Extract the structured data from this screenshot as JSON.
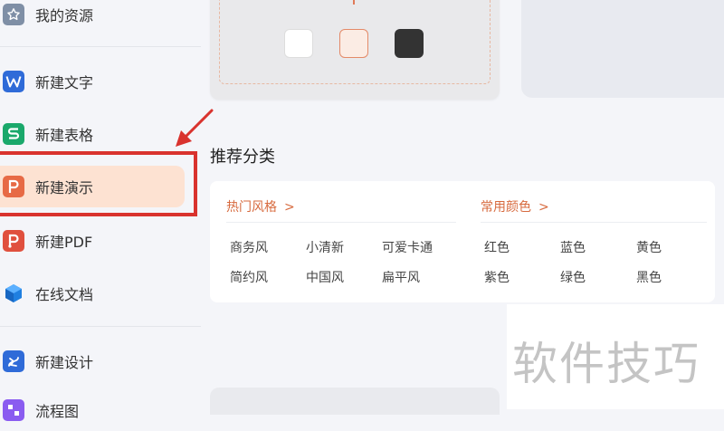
{
  "sidebar": {
    "items": [
      {
        "label": "我的资源",
        "icon": "star-icon",
        "color": "#7f8fa6"
      },
      {
        "label": "新建文字",
        "icon": "wps-writer-icon",
        "color": "#2f6bd8"
      },
      {
        "label": "新建表格",
        "icon": "wps-spreadsheet-icon",
        "color": "#1aa86b"
      },
      {
        "label": "新建演示",
        "icon": "wps-presentation-icon",
        "color": "#e76a45"
      },
      {
        "label": "新建PDF",
        "icon": "pdf-icon",
        "color": "#e0503e"
      },
      {
        "label": "在线文档",
        "icon": "online-doc-icon",
        "color": "#1f7fe0"
      },
      {
        "label": "新建设计",
        "icon": "design-icon",
        "color": "#2f6bd8"
      },
      {
        "label": "流程图",
        "icon": "flowchart-icon",
        "color": "#8a5cf0"
      }
    ],
    "active_index": 3
  },
  "template_preview": {
    "swatches": [
      "#ffffff",
      "#fbece4",
      "#333333"
    ],
    "selected_swatch": 1
  },
  "recommend": {
    "title": "推荐分类",
    "groups": [
      {
        "heading": "热门风格",
        "chevron": ">",
        "tags": [
          "商务风",
          "小清新",
          "可爱卡通",
          "简约风",
          "中国风",
          "扁平风"
        ]
      },
      {
        "heading": "常用颜色",
        "chevron": ">",
        "tags": [
          "红色",
          "蓝色",
          "黄色",
          "紫色",
          "绿色",
          "黑色"
        ]
      }
    ]
  },
  "watermark": "软件技巧",
  "colors": {
    "accent": "#d76a3e",
    "active_bg": "#fde2d2",
    "annotation_red": "#d9332e"
  }
}
